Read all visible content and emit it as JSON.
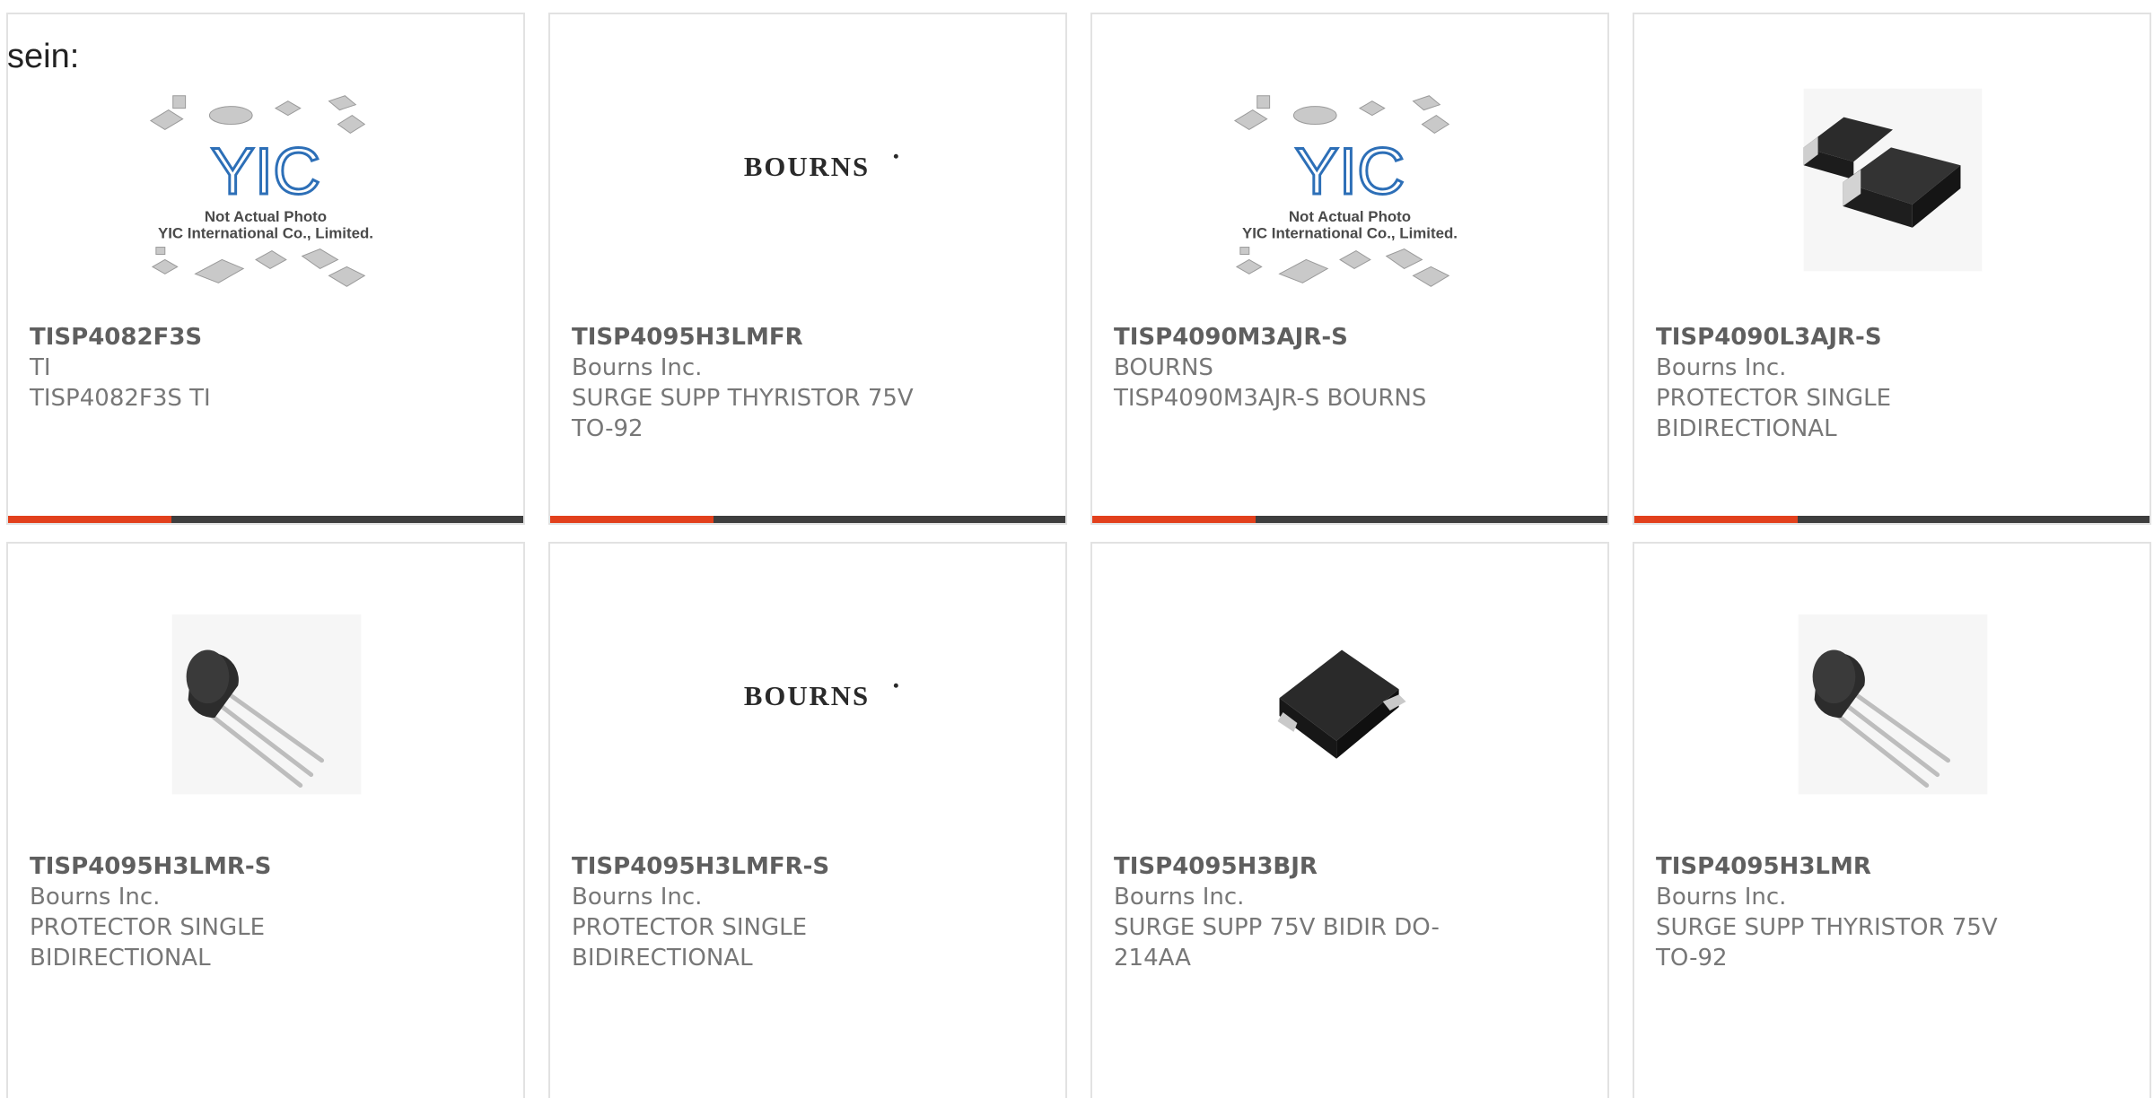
{
  "lead_text": "sein:",
  "colors": {
    "accent": "#e2401c",
    "bar": "#3e3e3e",
    "border": "#e2e2e2"
  },
  "placeholder": {
    "logo": "YIC",
    "caption_line1": "Not Actual Photo",
    "caption_line2": "YIC International Co., Limited."
  },
  "bourns_logo": "BOURNS",
  "products": [
    {
      "part": "TISP4082F3S",
      "maker": "TI",
      "desc": "TISP4082F3S TI",
      "image": "yic-placeholder"
    },
    {
      "part": "TISP4095H3LMFR",
      "maker": "Bourns Inc.",
      "desc": "SURGE SUPP THYRISTOR 75V TO-92",
      "image": "bourns-logo"
    },
    {
      "part": "TISP4090M3AJR-S",
      "maker": "BOURNS",
      "desc": "TISP4090M3AJR-S BOURNS",
      "image": "yic-placeholder"
    },
    {
      "part": "TISP4090L3AJR-S",
      "maker": "Bourns Inc.",
      "desc": "PROTECTOR SINGLE BIDIRECTIONAL",
      "image": "smd-diode"
    },
    {
      "part": "TISP4095H3LMR-S",
      "maker": "Bourns Inc.",
      "desc": "PROTECTOR SINGLE BIDIRECTIONAL",
      "image": "to92-transistor"
    },
    {
      "part": "TISP4095H3LMFR-S",
      "maker": "Bourns Inc.",
      "desc": "PROTECTOR SINGLE BIDIRECTIONAL",
      "image": "bourns-logo"
    },
    {
      "part": "TISP4095H3BJR",
      "maker": "Bourns Inc.",
      "desc": "SURGE SUPP 75V BIDIR DO-214AA",
      "image": "smb-package"
    },
    {
      "part": "TISP4095H3LMR",
      "maker": "Bourns Inc.",
      "desc": "SURGE SUPP THYRISTOR 75V TO-92",
      "image": "to92-transistor"
    }
  ]
}
